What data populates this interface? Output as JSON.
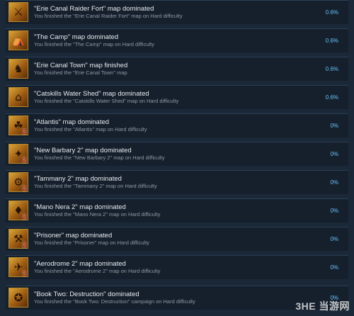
{
  "achievements": [
    {
      "title": "\"Erie Canal Raider Fort\" map dominated",
      "desc": "You finished the \"Erie Canal Raider Fort\" map on Hard difficulty",
      "percent": "0.6%",
      "icon": "fort-icon",
      "glyph": "⚔",
      "badge": ""
    },
    {
      "title": "\"The Camp\" map dominated",
      "desc": "You finished the \"The Camp\" map on Hard difficulty",
      "percent": "0.6%",
      "icon": "camp-icon",
      "glyph": "⛺",
      "badge": ""
    },
    {
      "title": "\"Erie Canal Town\" map finished",
      "desc": "You finished the \"Erie Canal Town\" map",
      "percent": "0.6%",
      "icon": "horse-icon",
      "glyph": "♞",
      "badge": ""
    },
    {
      "title": "\"Catskills Water Shed\" map dominated",
      "desc": "You finished the \"Catskills Water Shed\" map on Hard difficulty",
      "percent": "0.6%",
      "icon": "water-shed-icon",
      "glyph": "⌂",
      "badge": ""
    },
    {
      "title": "\"Atlantis\" map dominated",
      "desc": "You finished the \"Atlantis\" map on Hard difficulty",
      "percent": "0%",
      "icon": "atlantis-icon",
      "glyph": "☘",
      "badge": "2"
    },
    {
      "title": "\"New Barbary 2\" map dominated",
      "desc": "You finished the \"New Barbary 2\" map on Hard difficulty",
      "percent": "0%",
      "icon": "barbary-icon",
      "glyph": "✦",
      "badge": "2"
    },
    {
      "title": "\"Tammany 2\" map dominated",
      "desc": "You finished the \"Tammany 2\" map on Hard difficulty",
      "percent": "0%",
      "icon": "gear-icon",
      "glyph": "⚙",
      "badge": "2"
    },
    {
      "title": "\"Mano Nera 2\" map dominated",
      "desc": "You finished the \"Mano Nera 2\" map on Hard difficulty",
      "percent": "0%",
      "icon": "lantern-icon",
      "glyph": "♦",
      "badge": "2"
    },
    {
      "title": "\"Prisoner\" map dominated",
      "desc": "You finished the \"Prisoner\" map on Hard difficulty",
      "percent": "0%",
      "icon": "prisoner-icon",
      "glyph": "⚒",
      "badge": "2"
    },
    {
      "title": "\"Aerodrome 2\" map dominated",
      "desc": "You finished the \"Aerodrome 2\" map on Hard difficulty",
      "percent": "0%",
      "icon": "airship-icon",
      "glyph": "✈",
      "badge": "2"
    },
    {
      "title": "\"Book Two: Destruction\" dominated",
      "desc": "You finished the \"Book Two: Destruction\" campaign on Hard difficulty",
      "percent": "0%",
      "icon": "book-icon",
      "glyph": "✪",
      "badge": ""
    }
  ],
  "watermark": "3HE 当游网",
  "colors": {
    "background": "#1b2838",
    "row": "#16202d",
    "title": "#e6e9ec",
    "desc": "#8f98a0",
    "percent": "#66c0f4"
  }
}
